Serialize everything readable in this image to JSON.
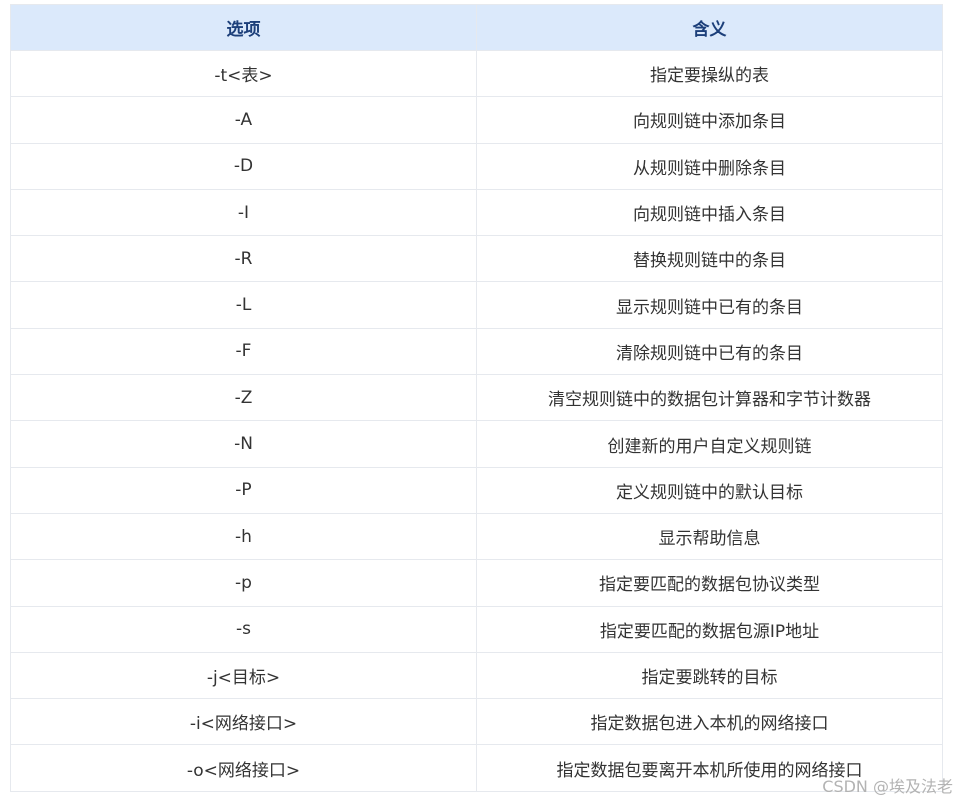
{
  "table": {
    "headers": [
      "选项",
      "含义"
    ],
    "rows": [
      [
        "-t<表>",
        "指定要操纵的表"
      ],
      [
        "-A",
        "向规则链中添加条目"
      ],
      [
        "-D",
        "从规则链中删除条目"
      ],
      [
        "-I",
        "向规则链中插入条目"
      ],
      [
        "-R",
        "替换规则链中的条目"
      ],
      [
        "-L",
        "显示规则链中已有的条目"
      ],
      [
        "-F",
        "清除规则链中已有的条目"
      ],
      [
        "-Z",
        "清空规则链中的数据包计算器和字节计数器"
      ],
      [
        "-N",
        "创建新的用户自定义规则链"
      ],
      [
        "-P",
        "定义规则链中的默认目标"
      ],
      [
        "-h",
        "显示帮助信息"
      ],
      [
        "-p",
        "指定要匹配的数据包协议类型"
      ],
      [
        "-s",
        "指定要匹配的数据包源IP地址"
      ],
      [
        "-j<目标>",
        "指定要跳转的目标"
      ],
      [
        "-i<网络接口>",
        "指定数据包进入本机的网络接口"
      ],
      [
        "-o<网络接口>",
        "指定数据包要离开本机所使用的网络接口"
      ]
    ]
  },
  "watermark": "CSDN @埃及法老",
  "colors": {
    "header_bg": "#dbe9fb",
    "header_text": "#1c3f7a",
    "border": "#e6e9ee"
  }
}
